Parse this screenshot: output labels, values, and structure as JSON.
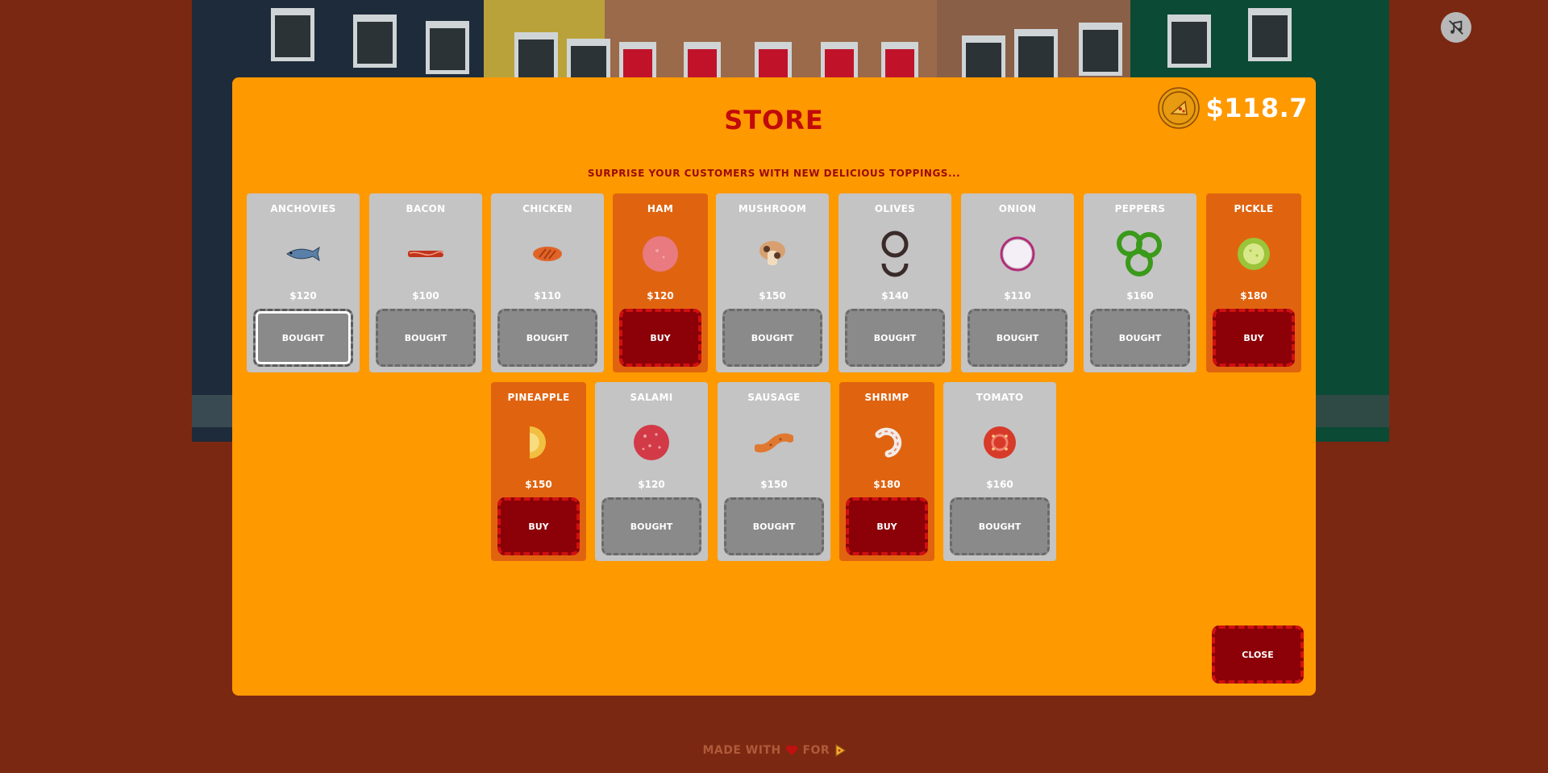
{
  "mute_button": {
    "icon": "music-off-icon"
  },
  "store": {
    "title": "Store",
    "subtitle": "Surprise your customers with new delicious toppings...",
    "money": "$118.7",
    "coin_icon": "pizza-coin-icon",
    "close_label": "Close"
  },
  "toppings": [
    {
      "name": "Anchovies",
      "price": "$120",
      "action": "Bought",
      "icon": "anchovy-icon"
    },
    {
      "name": "Bacon",
      "price": "$100",
      "action": "Bought",
      "icon": "bacon-icon"
    },
    {
      "name": "Chicken",
      "price": "$110",
      "action": "Bought",
      "icon": "chicken-icon"
    },
    {
      "name": "Ham",
      "price": "$120",
      "action": "Buy",
      "icon": "ham-icon"
    },
    {
      "name": "Mushroom",
      "price": "$150",
      "action": "Bought",
      "icon": "mushroom-icon"
    },
    {
      "name": "Olives",
      "price": "$140",
      "action": "Bought",
      "icon": "olives-icon"
    },
    {
      "name": "Onion",
      "price": "$110",
      "action": "Bought",
      "icon": "onion-icon"
    },
    {
      "name": "Peppers",
      "price": "$160",
      "action": "Bought",
      "icon": "peppers-icon"
    },
    {
      "name": "Pickle",
      "price": "$180",
      "action": "Buy",
      "icon": "pickle-icon"
    },
    {
      "name": "Pineapple",
      "price": "$150",
      "action": "Buy",
      "icon": "pineapple-icon"
    },
    {
      "name": "Salami",
      "price": "$120",
      "action": "Bought",
      "icon": "salami-icon"
    },
    {
      "name": "Sausage",
      "price": "$150",
      "action": "Bought",
      "icon": "sausage-icon"
    },
    {
      "name": "Shrimp",
      "price": "$180",
      "action": "Buy",
      "icon": "shrimp-icon"
    },
    {
      "name": "Tomato",
      "price": "$160",
      "action": "Bought",
      "icon": "tomato-icon"
    }
  ],
  "footer": {
    "made_with": "Made with",
    "for": "for",
    "heart_icon": "heart-icon",
    "pizza_icon": "pizza-icon"
  },
  "colors": {
    "background": "#7a2812",
    "modal": "#ff9900",
    "title": "#c10a0a",
    "buy_button": "#8c0008",
    "bought_card": "#c4c4c4",
    "buy_card": "#e06410"
  }
}
